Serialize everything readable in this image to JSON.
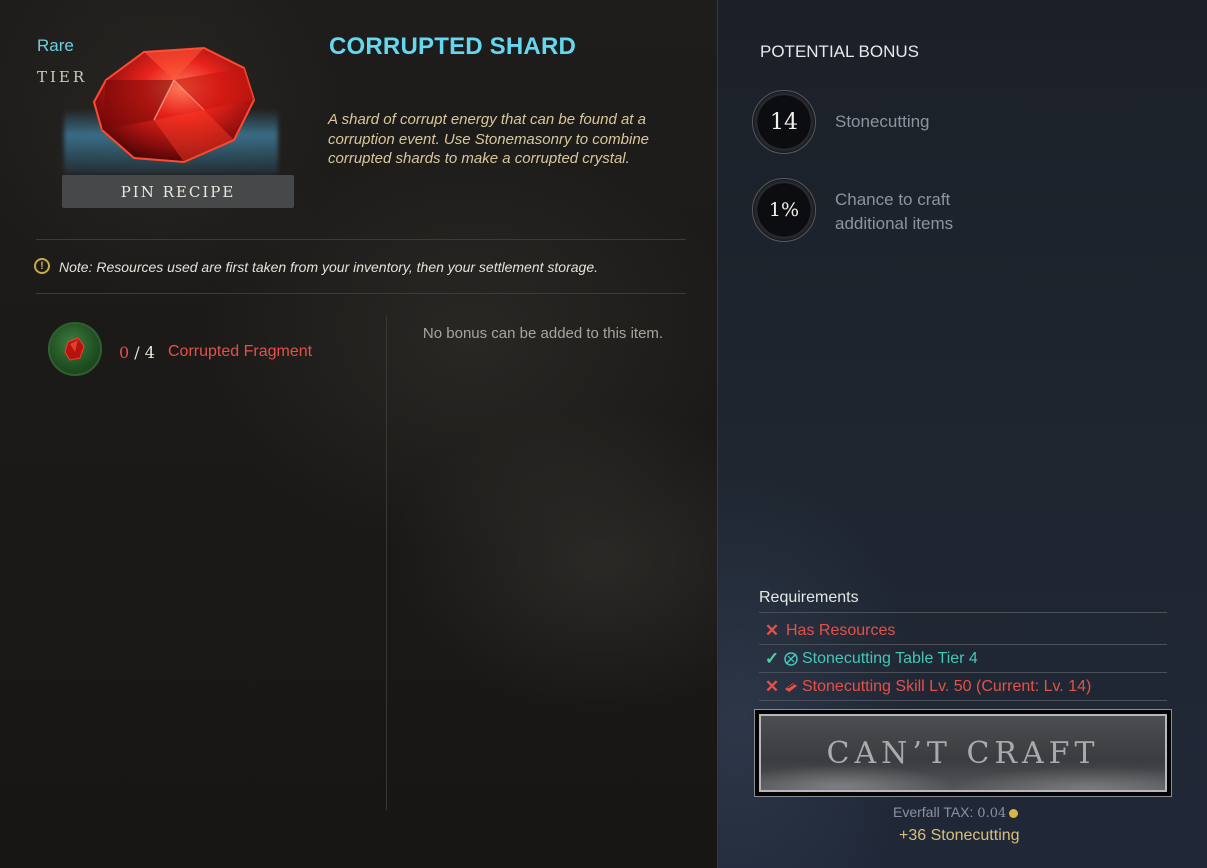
{
  "item": {
    "rarity": "Rare",
    "tier_label": "TIER",
    "title": "CORRUPTED SHARD",
    "description": "A shard of corrupt energy that can be found at a corruption event. Use Stonemasonry to combine corrupted shards to make a corrupted crystal.",
    "pin_label": "PIN RECIPE",
    "image_icon": "red-crystal-shard"
  },
  "note": {
    "icon": "warning-icon",
    "text": "Note: Resources used are first taken from your inventory, then your settlement storage."
  },
  "resources": [
    {
      "have": "0",
      "sep": "/",
      "need": "4",
      "name": "Corrupted Fragment",
      "icon": "corrupted-fragment-icon"
    }
  ],
  "bonus_panel": {
    "text": "No bonus can be added to this item."
  },
  "potential_bonus": {
    "title": "POTENTIAL BONUS",
    "items": [
      {
        "value": "14",
        "label": "Stonecutting"
      },
      {
        "value": "1%",
        "label": "Chance to craft additional items"
      }
    ]
  },
  "requirements": {
    "title": "Requirements",
    "items": [
      {
        "status": "fail",
        "label": "Has Resources"
      },
      {
        "status": "pass",
        "icon": "station-icon",
        "label": "Stonecutting Table Tier 4"
      },
      {
        "status": "fail",
        "icon": "skill-icon",
        "label": "Stonecutting Skill Lv. 50 (Current: Lv. 14)"
      }
    ]
  },
  "craft": {
    "button_label": "CAN’T CRAFT",
    "tax_label": "Everfall TAX:",
    "tax_value": "0.04",
    "xp_gain": "+36 Stonecutting"
  },
  "colors": {
    "title_cyan": "#63d8f2",
    "fail_red": "#e5504a",
    "pass_teal": "#45c6b8",
    "desc_gold": "#d8c79c"
  }
}
